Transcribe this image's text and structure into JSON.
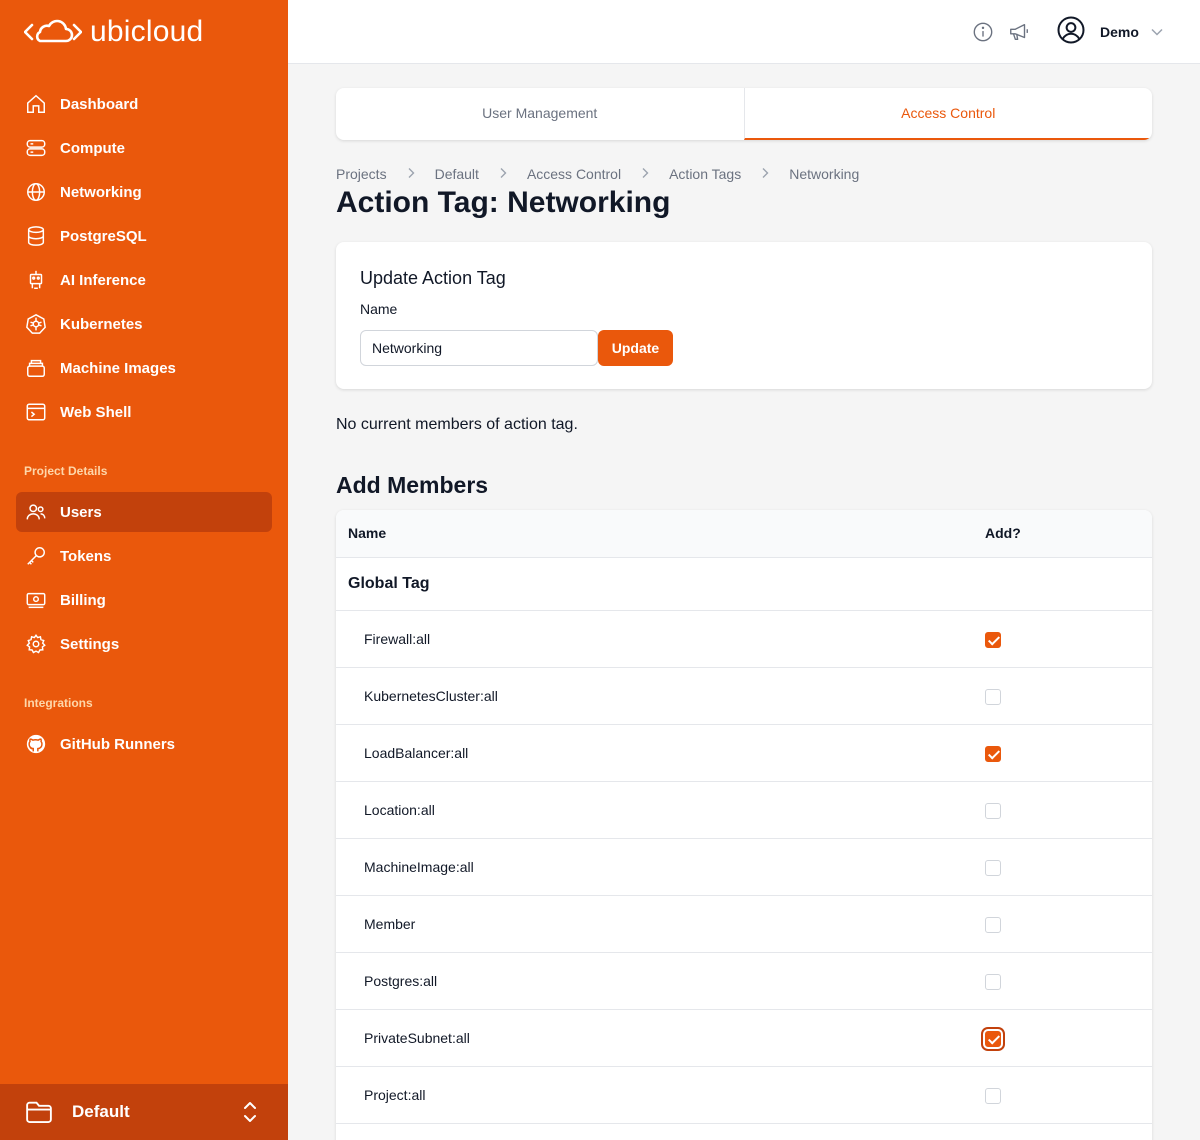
{
  "brand": {
    "name": "ubicloud"
  },
  "sidebar": {
    "items": [
      {
        "label": "Dashboard",
        "icon": "home-icon"
      },
      {
        "label": "Compute",
        "icon": "server-icon"
      },
      {
        "label": "Networking",
        "icon": "globe-icon"
      },
      {
        "label": "PostgreSQL",
        "icon": "database-icon"
      },
      {
        "label": "AI Inference",
        "icon": "robot-icon"
      },
      {
        "label": "Kubernetes",
        "icon": "kubernetes-icon"
      },
      {
        "label": "Machine Images",
        "icon": "layers-icon"
      },
      {
        "label": "Web Shell",
        "icon": "terminal-icon"
      }
    ],
    "section_project": "Project Details",
    "project_items": [
      {
        "label": "Users",
        "icon": "users-icon",
        "active": true
      },
      {
        "label": "Tokens",
        "icon": "key-icon"
      },
      {
        "label": "Billing",
        "icon": "billing-icon"
      },
      {
        "label": "Settings",
        "icon": "gear-icon"
      }
    ],
    "section_integrations": "Integrations",
    "integration_items": [
      {
        "label": "GitHub Runners",
        "icon": "github-icon"
      }
    ],
    "project_switcher": "Default"
  },
  "header": {
    "user_name": "Demo"
  },
  "tabs": [
    {
      "label": "User Management",
      "active": false
    },
    {
      "label": "Access Control",
      "active": true
    }
  ],
  "breadcrumb": [
    "Projects",
    "Default",
    "Access Control",
    "Action Tags",
    "Networking"
  ],
  "page_title": "Action Tag: Networking",
  "update_card": {
    "title": "Update Action Tag",
    "name_label": "Name",
    "name_value": "Networking",
    "button_label": "Update"
  },
  "no_members_text": "No current members of action tag.",
  "add_members": {
    "title": "Add Members",
    "col_name": "Name",
    "col_add": "Add?",
    "group_label": "Global Tag",
    "rows": [
      {
        "label": "Firewall:all",
        "checked": true
      },
      {
        "label": "KubernetesCluster:all",
        "checked": false
      },
      {
        "label": "LoadBalancer:all",
        "checked": true
      },
      {
        "label": "Location:all",
        "checked": false
      },
      {
        "label": "MachineImage:all",
        "checked": false
      },
      {
        "label": "Member",
        "checked": false
      },
      {
        "label": "Postgres:all",
        "checked": false
      },
      {
        "label": "PrivateSubnet:all",
        "checked": true,
        "focused": true
      },
      {
        "label": "Project:all",
        "checked": false
      }
    ]
  },
  "colors": {
    "accent": "#ea580c",
    "accent_dark": "#c2410c"
  }
}
